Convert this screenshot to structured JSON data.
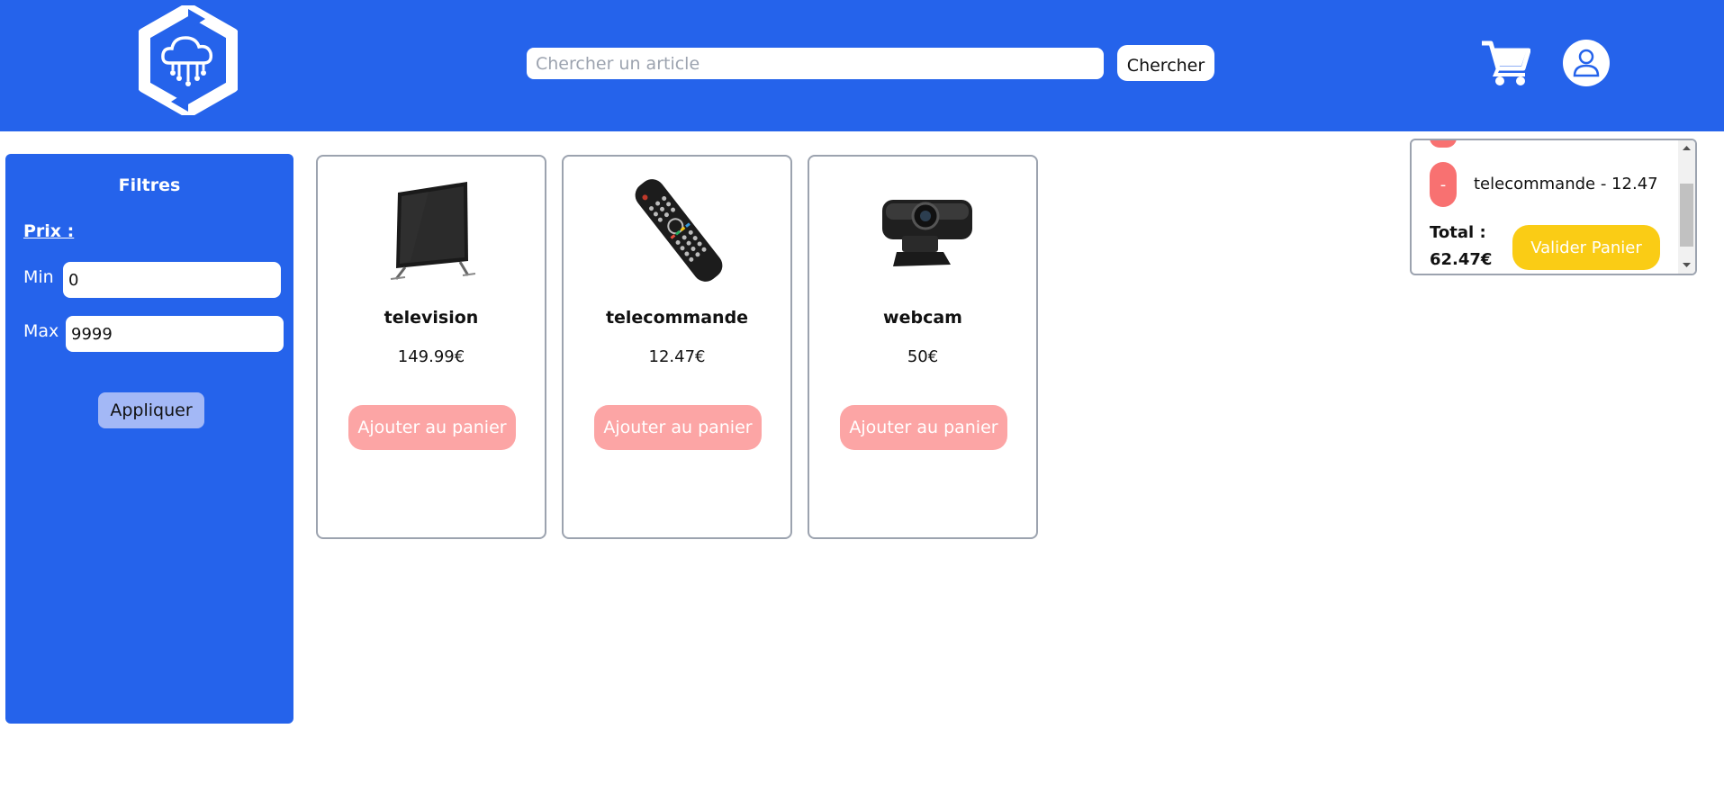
{
  "header": {
    "logo_name": "cloud-hexagon-logo",
    "search_placeholder": "Chercher un article",
    "search_button": "Chercher",
    "cart_icon": "shopping-cart-icon",
    "user_icon": "user-icon",
    "brand_color": "#2563eb"
  },
  "filters": {
    "title": "Filtres",
    "price_label": "Prix :",
    "min_label": "Min",
    "min_value": "0",
    "max_label": "Max",
    "max_value": "9999",
    "apply_button": "Appliquer"
  },
  "products": [
    {
      "name": "television",
      "price": "149.99€",
      "button": "Ajouter au panier",
      "image": "television-image"
    },
    {
      "name": "telecommande",
      "price": "12.47€",
      "button": "Ajouter au panier",
      "image": "remote-control-image"
    },
    {
      "name": "webcam",
      "price": "50€",
      "button": "Ajouter au panier",
      "image": "webcam-image"
    }
  ],
  "cart": {
    "items": [
      {
        "remove_label": "-",
        "text": "telecommande - 12.47"
      }
    ],
    "total_label": "Total :",
    "total_value": "62.47€",
    "validate_button": "Valider Panier"
  },
  "colors": {
    "add_button": "#fca5a5",
    "remove_button": "#f87171",
    "validate_button": "#facc15"
  }
}
